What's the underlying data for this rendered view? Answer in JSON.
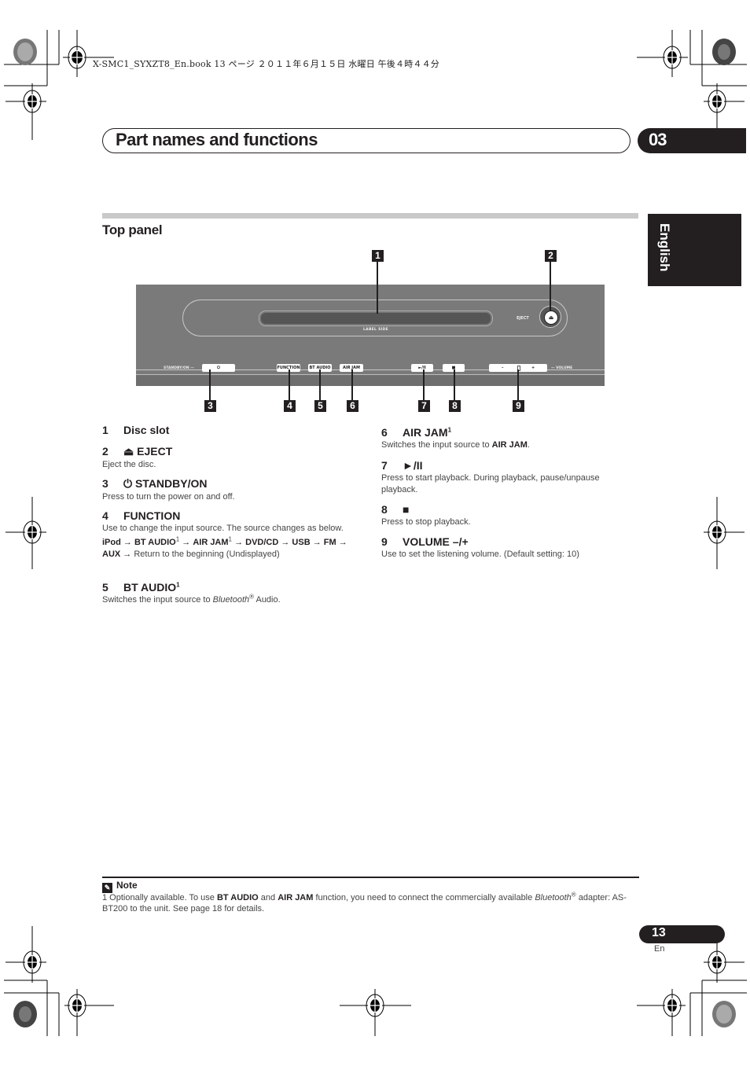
{
  "header": {
    "file_meta": "X-SMC1_SYXZT8_En.book  13 ページ  ２０１１年６月１５日  水曜日  午後４時４４分",
    "chapter_title": "Part names and functions",
    "chapter_number": "03",
    "language_tab": "English"
  },
  "section": {
    "title": "Top panel"
  },
  "device": {
    "label_side": "LABEL SIDE",
    "eject_label": "EJECT",
    "eject_glyph": "⏏",
    "standby_label": "STANDBY/ON —",
    "standby_glyph": "⏻",
    "function_btn": "FUNCTION",
    "bt_audio_btn": "BT AUDIO",
    "air_jam_btn": "AIR JAM",
    "play_pause_glyph": "►/II",
    "stop_glyph": "■",
    "vol_minus": "–",
    "vol_plus": "+",
    "volume_label": "— VOLUME",
    "callouts": [
      "1",
      "2",
      "3",
      "4",
      "5",
      "6",
      "7",
      "8",
      "9"
    ]
  },
  "items_left": [
    {
      "num": "1",
      "title": "Disc slot",
      "desc": ""
    },
    {
      "num": "2",
      "title": "⏏ EJECT",
      "desc": "Eject the disc."
    },
    {
      "num": "3",
      "title": "⏻ STANDBY/ON",
      "desc": "Press to turn the power on and off."
    },
    {
      "num": "4",
      "title": "FUNCTION",
      "desc": "Use to change the input source. The source changes as below."
    },
    {
      "num": "5",
      "title": "BT AUDIO",
      "sup": "1",
      "desc_pre": "Switches the input source to ",
      "desc_italic": "Bluetooth",
      "desc_reg": "®",
      "desc_post": " Audio."
    }
  ],
  "function_sequence": {
    "ipod": "iPod",
    "arrow": "→",
    "bt_audio": "BT AUDIO",
    "sup": "1",
    "air_jam": "AIR JAM",
    "dvd": "DVD/CD",
    "usb": "USB",
    "fm": "FM",
    "aux": "AUX",
    "return": "Return to the beginning (Undisplayed)"
  },
  "items_right": [
    {
      "num": "6",
      "title": "AIR JAM",
      "sup": "1",
      "desc_pre": "Switches the input source to ",
      "desc_bold": "AIR JAM",
      "desc_post": "."
    },
    {
      "num": "7",
      "title": "►/II",
      "desc": "Press to start playback. During playback, pause/unpause playback."
    },
    {
      "num": "8",
      "title": "■",
      "desc": "Press to stop playback."
    },
    {
      "num": "9",
      "title": "VOLUME –/+",
      "desc": "Use to set the listening volume. (Default setting: 10)"
    }
  ],
  "note": {
    "heading": "Note",
    "icon": "✎",
    "num": "1",
    "t1": " Optionally available. To use ",
    "b1": "BT AUDIO",
    "t2": " and ",
    "b2": "AIR JAM",
    "t3": " function, you need to connect the commercially available ",
    "i1": "Bluetooth",
    "reg": "®",
    "t4": " adapter: AS-BT200 to the unit. See page 18 for details."
  },
  "footer": {
    "page_number": "13",
    "page_lang": "En"
  }
}
